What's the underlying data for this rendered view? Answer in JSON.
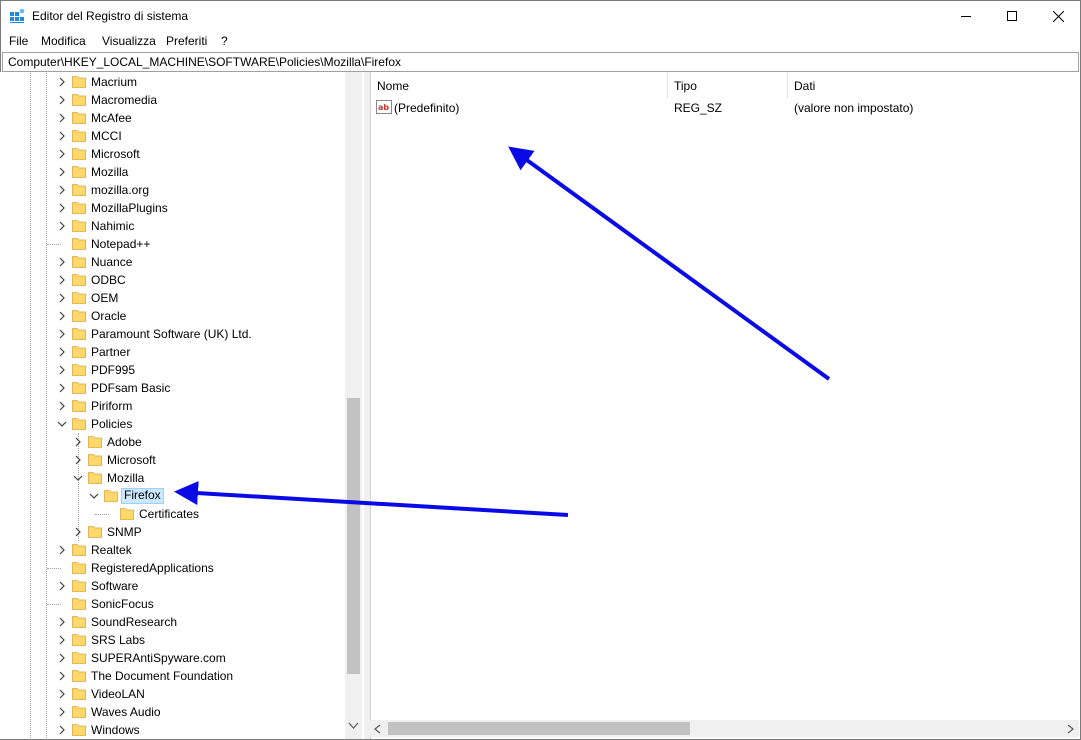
{
  "window": {
    "title": "Editor del Registro di sistema"
  },
  "menu": [
    "File",
    "Modifica",
    "Visualizza",
    "Preferiti",
    "?"
  ],
  "address": "Computer\\HKEY_LOCAL_MACHINE\\SOFTWARE\\Policies\\Mozilla\\Firefox",
  "tree": [
    {
      "label": "Macrium",
      "level": 0,
      "expander": "collapsed"
    },
    {
      "label": "Macromedia",
      "level": 0,
      "expander": "collapsed"
    },
    {
      "label": "McAfee",
      "level": 0,
      "expander": "collapsed"
    },
    {
      "label": "MCCI",
      "level": 0,
      "expander": "collapsed"
    },
    {
      "label": "Microsoft",
      "level": 0,
      "expander": "collapsed"
    },
    {
      "label": "Mozilla",
      "level": 0,
      "expander": "collapsed"
    },
    {
      "label": "mozilla.org",
      "level": 0,
      "expander": "collapsed"
    },
    {
      "label": "MozillaPlugins",
      "level": 0,
      "expander": "collapsed"
    },
    {
      "label": "Nahimic",
      "level": 0,
      "expander": "collapsed"
    },
    {
      "label": "Notepad++",
      "level": 0,
      "expander": "none"
    },
    {
      "label": "Nuance",
      "level": 0,
      "expander": "collapsed"
    },
    {
      "label": "ODBC",
      "level": 0,
      "expander": "collapsed"
    },
    {
      "label": "OEM",
      "level": 0,
      "expander": "collapsed"
    },
    {
      "label": "Oracle",
      "level": 0,
      "expander": "collapsed"
    },
    {
      "label": "Paramount Software (UK) Ltd.",
      "level": 0,
      "expander": "collapsed"
    },
    {
      "label": "Partner",
      "level": 0,
      "expander": "collapsed"
    },
    {
      "label": "PDF995",
      "level": 0,
      "expander": "collapsed"
    },
    {
      "label": "PDFsam Basic",
      "level": 0,
      "expander": "collapsed"
    },
    {
      "label": "Piriform",
      "level": 0,
      "expander": "collapsed"
    },
    {
      "label": "Policies",
      "level": 0,
      "expander": "expanded"
    },
    {
      "label": "Adobe",
      "level": 1,
      "expander": "collapsed"
    },
    {
      "label": "Microsoft",
      "level": 1,
      "expander": "collapsed"
    },
    {
      "label": "Mozilla",
      "level": 1,
      "expander": "expanded"
    },
    {
      "label": "Firefox",
      "level": 2,
      "expander": "expanded",
      "selected": true
    },
    {
      "label": "Certificates",
      "level": 3,
      "expander": "none"
    },
    {
      "label": "SNMP",
      "level": 1,
      "expander": "collapsed"
    },
    {
      "label": "Realtek",
      "level": 0,
      "expander": "collapsed"
    },
    {
      "label": "RegisteredApplications",
      "level": 0,
      "expander": "none"
    },
    {
      "label": "Software",
      "level": 0,
      "expander": "collapsed"
    },
    {
      "label": "SonicFocus",
      "level": 0,
      "expander": "none"
    },
    {
      "label": "SoundResearch",
      "level": 0,
      "expander": "collapsed"
    },
    {
      "label": "SRS Labs",
      "level": 0,
      "expander": "collapsed"
    },
    {
      "label": "SUPERAntiSpyware.com",
      "level": 0,
      "expander": "collapsed"
    },
    {
      "label": "The Document Foundation",
      "level": 0,
      "expander": "collapsed"
    },
    {
      "label": "VideoLAN",
      "level": 0,
      "expander": "collapsed"
    },
    {
      "label": "Waves Audio",
      "level": 0,
      "expander": "collapsed"
    },
    {
      "label": "Windows",
      "level": 0,
      "expander": "collapsed"
    }
  ],
  "columns": {
    "name": "Nome",
    "type": "Tipo",
    "data": "Dati"
  },
  "values": [
    {
      "name": "(Predefinito)",
      "type": "REG_SZ",
      "data": "(valore non impostato)",
      "icon": "string-value-icon"
    }
  ],
  "colors": {
    "selection": "#cce8ff",
    "arrow": "#0a0ae6",
    "folder": "#ffd86b"
  }
}
